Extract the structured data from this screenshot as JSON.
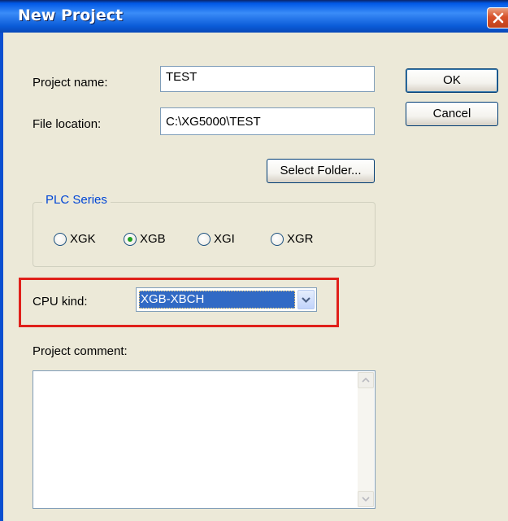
{
  "window": {
    "title": "New Project"
  },
  "form": {
    "project_name_label": "Project name:",
    "project_name_value": "TEST",
    "file_location_label": "File location:",
    "file_location_value": "C:\\XG5000\\TEST",
    "select_folder_label": "Select Folder...",
    "ok_label": "OK",
    "cancel_label": "Cancel"
  },
  "plc_series": {
    "legend": "PLC Series",
    "options": [
      "XGK",
      "XGB",
      "XGI",
      "XGR"
    ],
    "selected": "XGB"
  },
  "cpu": {
    "label": "CPU kind:",
    "selected": "XGB-XBCH"
  },
  "comment": {
    "label": "Project comment:",
    "value": ""
  },
  "colors": {
    "highlight_box": "#E0201A",
    "selection": "#316AC5",
    "radio_dot": "#21A121",
    "group_legend": "#0046D5"
  }
}
